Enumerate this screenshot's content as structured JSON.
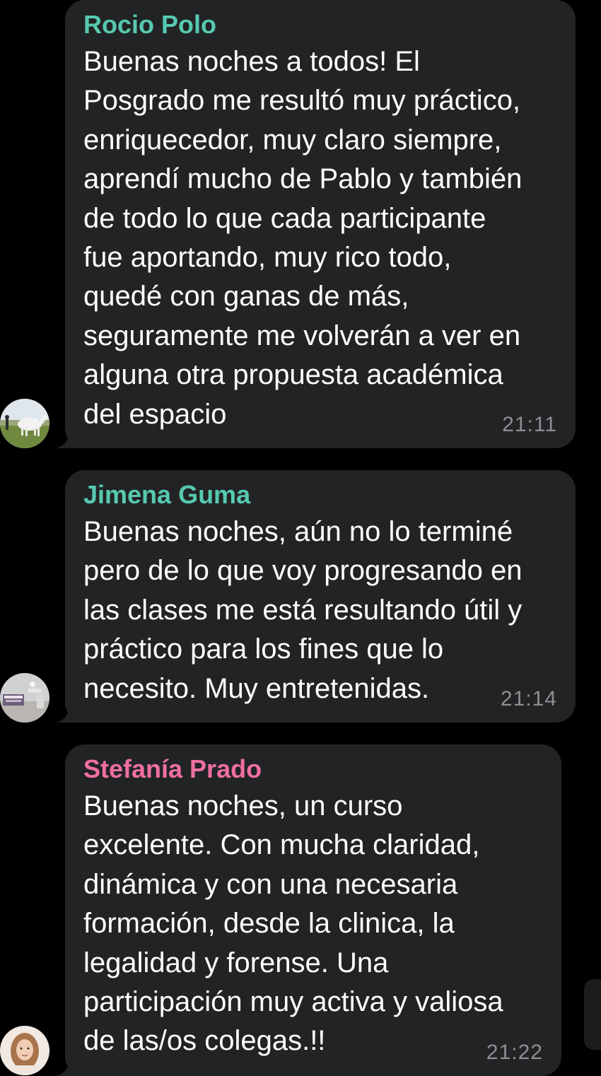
{
  "messages": [
    {
      "sender": "Rocio Polo",
      "sender_color": "#56c9b0",
      "text": "Buenas noches a todos! El\nPosgrado me resultó muy práctico,\nenriquecedor, muy claro siempre,\naprendí mucho de Pablo y también\nde todo lo que cada participante\nfue aportando, muy rico todo,\nquedé con ganas de más,\nseguramente me volverán a ver en\nalguna otra propuesta académica\ndel espacio",
      "time": "21:11",
      "avatar_icon": "horse-photo"
    },
    {
      "sender": "Jimena Guma",
      "sender_color": "#56c9b0",
      "text": "Buenas noches, aún no lo terminé\npero de lo que voy progresando en\nlas clases me está resultando útil y\npráctico para los fines que lo\nnecesito. Muy entretenidas.",
      "time": "21:14",
      "avatar_icon": "room-photo"
    },
    {
      "sender": "Stefanía Prado",
      "sender_color": "#ef6fa0",
      "text": "Buenas noches, un curso\nexcelente. Con mucha claridad,\ndinámica y con una necesaria\nformación, desde la clinica, la\nlegalidad y forense. Una\nparticipación muy activa y valiosa\nde las/os colegas.!!",
      "time": "21:22",
      "avatar_icon": "portrait-photo"
    }
  ],
  "colors": {
    "background": "#000000",
    "bubble": "#222324",
    "message_text": "#ffffff",
    "timestamp": "#8e8e93"
  }
}
